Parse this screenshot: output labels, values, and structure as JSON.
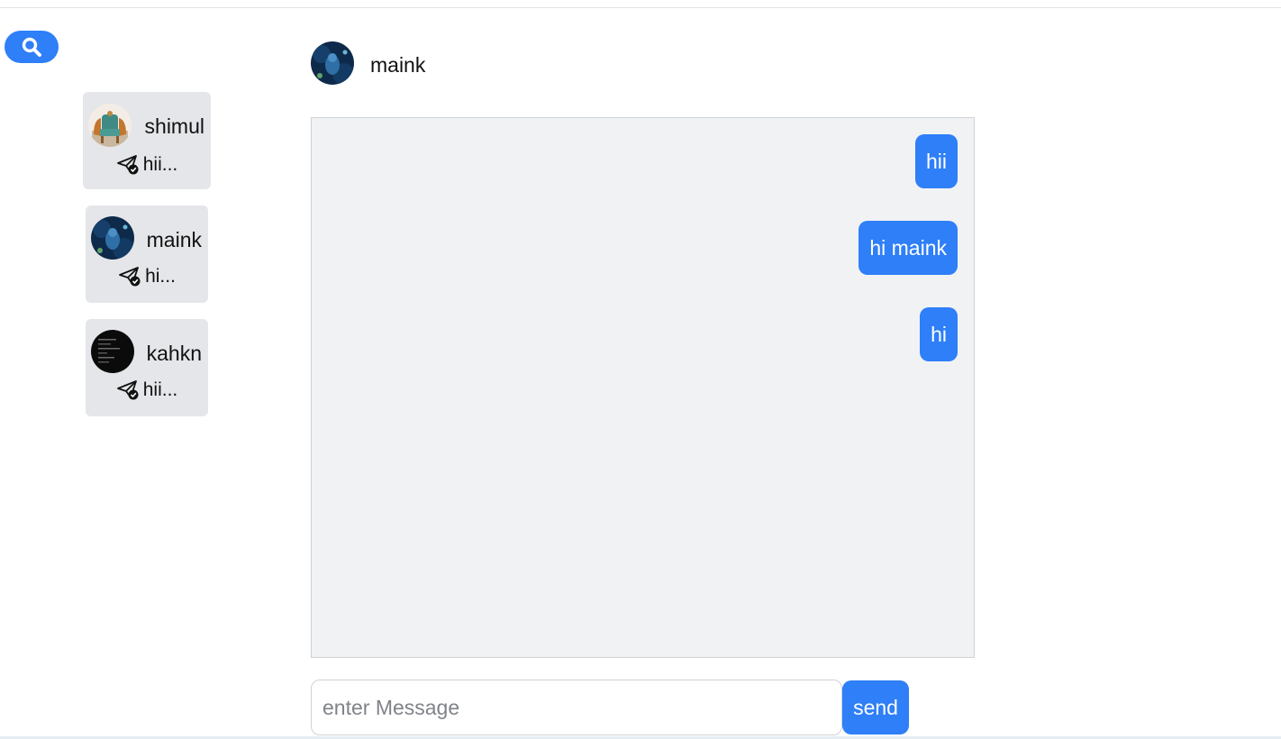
{
  "search": {
    "icon": "search-icon",
    "color": "#2e7ff8"
  },
  "contacts": [
    {
      "name": "shimul",
      "last_message": "hii...",
      "status_icon": "sent-check-icon",
      "avatar": "avatar-chairs-image"
    },
    {
      "name": "maink",
      "last_message": "hi...",
      "status_icon": "sent-check-icon",
      "avatar": "avatar-blue-art-image"
    },
    {
      "name": "kahkn",
      "last_message": "hii...",
      "status_icon": "sent-check-icon",
      "avatar": "avatar-dark-terminal-image"
    }
  ],
  "chat": {
    "recipient_name": "maink",
    "messages": [
      {
        "text": "hii",
        "direction": "outgoing"
      },
      {
        "text": "hi maink",
        "direction": "outgoing"
      },
      {
        "text": "hi",
        "direction": "outgoing"
      }
    ]
  },
  "composer": {
    "placeholder": "enter Message",
    "value": "",
    "send_label": "send"
  },
  "colors": {
    "accent": "#2e7ff8",
    "card_background": "#e5e6e9",
    "chat_background": "#f1f2f4"
  }
}
